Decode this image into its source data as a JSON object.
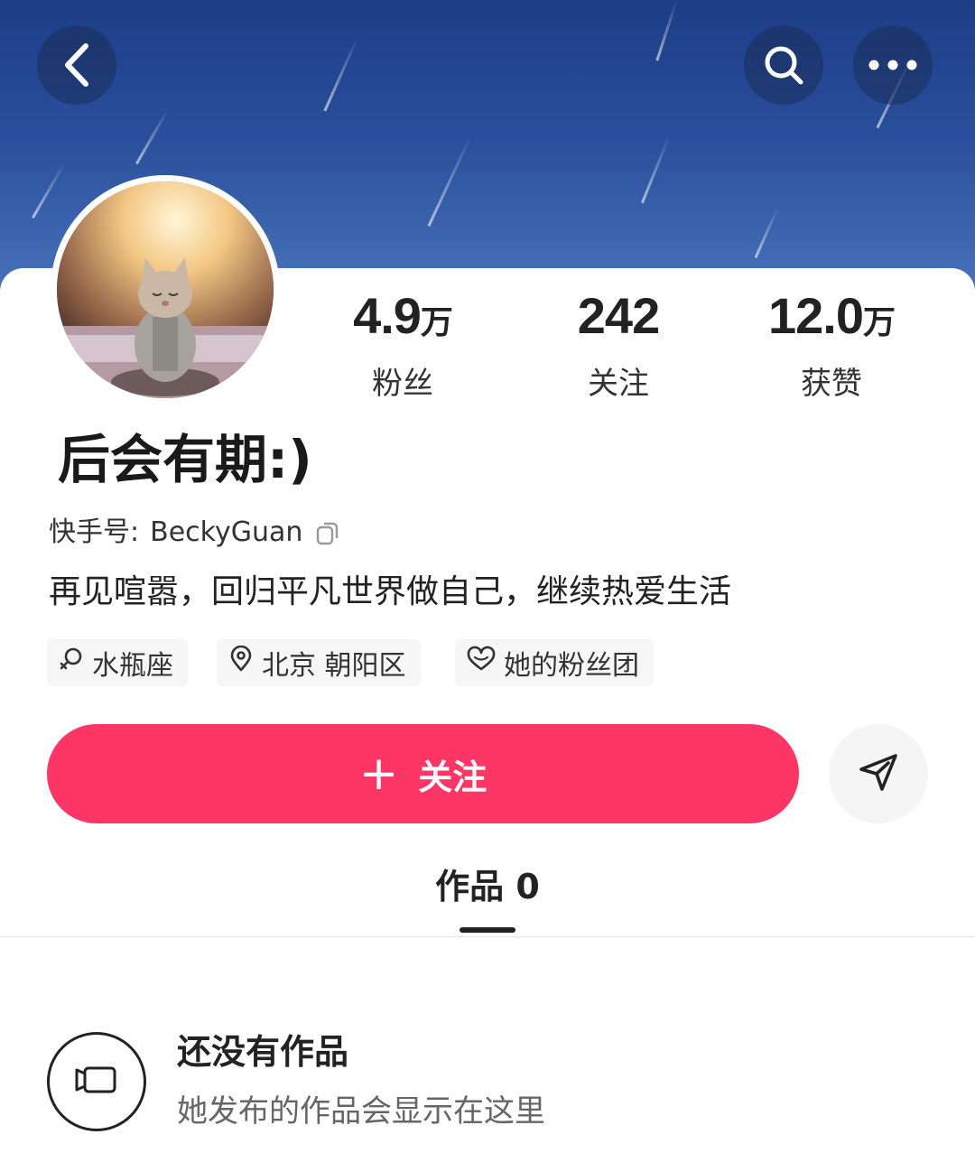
{
  "header": {
    "back_icon": "chevron-left-icon",
    "search_icon": "search-icon",
    "more_icon": "more-dots-icon"
  },
  "profile": {
    "nickname": "后会有期:)",
    "kwai_id_label": "快手号:",
    "kwai_id": "BeckyGuan",
    "bio": "再见喧嚣，回归平凡世界做自己，继续热爱生活"
  },
  "stats": [
    {
      "number": "4.9",
      "unit": "万",
      "label": "粉丝"
    },
    {
      "number": "242",
      "unit": "",
      "label": "关注"
    },
    {
      "number": "12.0",
      "unit": "万",
      "label": "获赞"
    }
  ],
  "tags": [
    {
      "icon": "zodiac-icon",
      "label": "水瓶座"
    },
    {
      "icon": "location-pin-icon",
      "label": "北京 朝阳区"
    },
    {
      "icon": "heart-icon",
      "label": "她的粉丝团"
    }
  ],
  "actions": {
    "follow_plus": "+",
    "follow_label": "关注",
    "share_icon": "send-icon"
  },
  "tabs": {
    "works_label": "作品 0"
  },
  "empty_state": {
    "icon": "video-camera-icon",
    "title": "还没有作品",
    "description": "她发布的作品会显示在这里"
  },
  "colors": {
    "follow_button": "#fe3666",
    "header_background": "#2a4f9c"
  }
}
